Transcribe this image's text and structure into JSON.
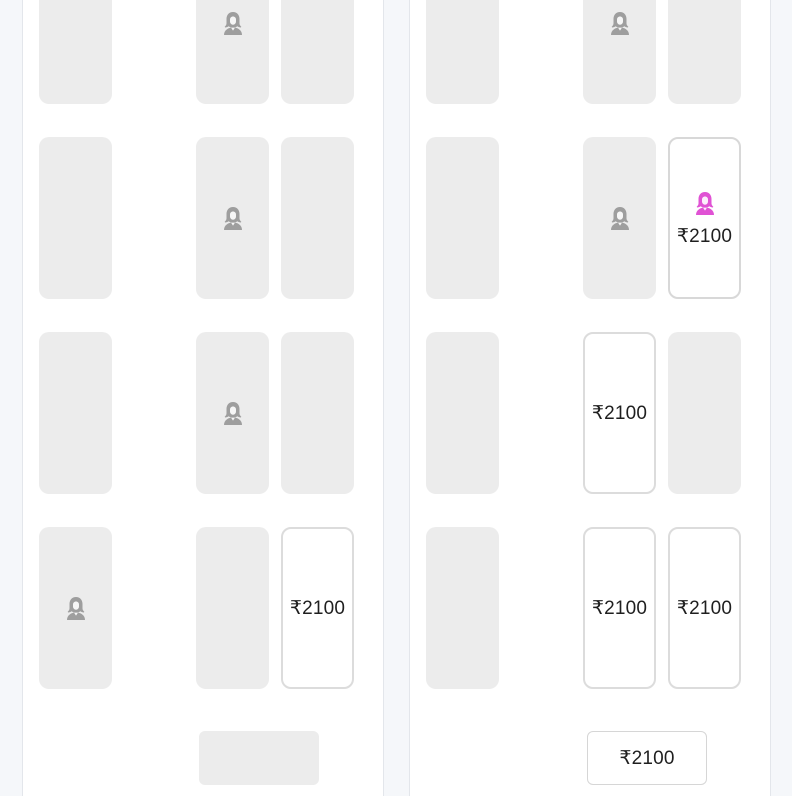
{
  "currency": "₹",
  "colors": {
    "booked_seat": "#ececec",
    "available_border": "#dcdcdc",
    "ladies_icon_booked": "#9e9e9e",
    "ladies_icon_available": "#e052d4",
    "page_background": "#f5f7fa"
  },
  "icons": {
    "ladies_seat": "female-person-icon"
  },
  "decks": {
    "left": {
      "berths": [
        {
          "status": "booked",
          "ladies": false
        },
        {
          "status": "booked",
          "ladies": true
        },
        {
          "status": "booked",
          "ladies": false
        },
        {
          "status": "booked",
          "ladies": false
        },
        {
          "status": "booked",
          "ladies": true
        },
        {
          "status": "booked",
          "ladies": false
        },
        {
          "status": "booked",
          "ladies": false
        },
        {
          "status": "booked",
          "ladies": true
        },
        {
          "status": "booked",
          "ladies": false
        },
        {
          "status": "booked",
          "ladies": true
        },
        {
          "status": "booked",
          "ladies": false
        },
        {
          "status": "available",
          "ladies": false,
          "price": "₹2100"
        }
      ],
      "bottom_seat": {
        "status": "booked"
      }
    },
    "right": {
      "berths": [
        {
          "status": "booked",
          "ladies": false
        },
        {
          "status": "booked",
          "ladies": true
        },
        {
          "status": "booked",
          "ladies": false
        },
        {
          "status": "booked",
          "ladies": false
        },
        {
          "status": "booked",
          "ladies": true
        },
        {
          "status": "available",
          "ladies": true,
          "price": "₹2100"
        },
        {
          "status": "booked",
          "ladies": false
        },
        {
          "status": "available",
          "ladies": false,
          "price": "₹2100"
        },
        {
          "status": "booked",
          "ladies": false
        },
        {
          "status": "booked",
          "ladies": false
        },
        {
          "status": "available",
          "ladies": false,
          "price": "₹2100"
        },
        {
          "status": "available",
          "ladies": false,
          "price": "₹2100"
        }
      ],
      "bottom_seat": {
        "status": "available",
        "price": "₹2100"
      }
    }
  }
}
